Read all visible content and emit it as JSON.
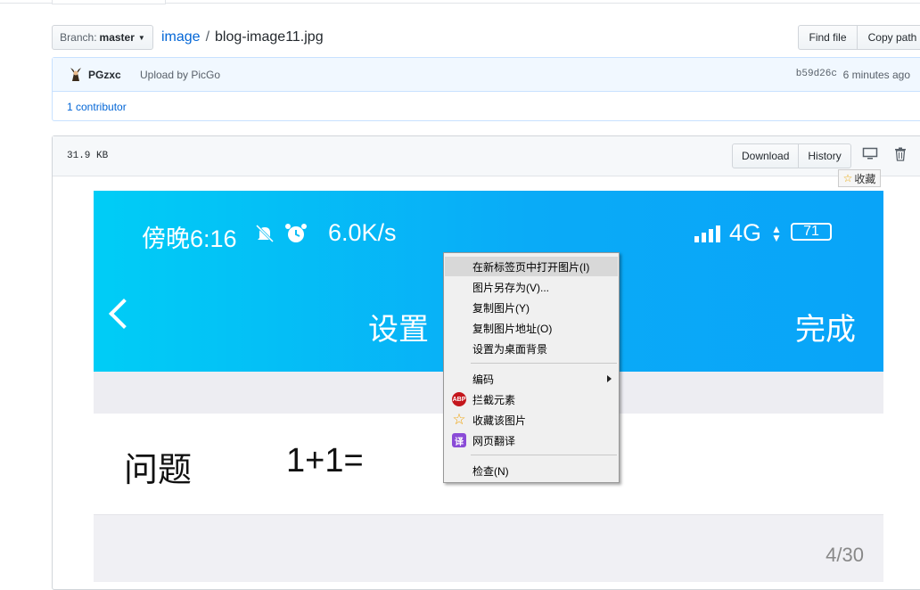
{
  "repo": {
    "branch_label": "Branch:",
    "branch_value": "master",
    "crumb_root": "image",
    "crumb_sep": "/",
    "file_name": "blog-image11.jpg",
    "find_file": "Find file",
    "copy_path": "Copy path"
  },
  "commit": {
    "author": "PGzxc",
    "message": "Upload by PicGo",
    "sha": "b59d26c",
    "time_ago": "6 minutes ago",
    "contributors": "1 contributor"
  },
  "file": {
    "size": "31.9 KB",
    "download": "Download",
    "history": "History",
    "tooltip": "收藏"
  },
  "phone": {
    "time": "傍晚6:16",
    "speed": "6.0K/s",
    "network": "4G",
    "battery": "71",
    "title": "设置",
    "done": "完成",
    "question_label": "问题",
    "question_value": "1+1=",
    "page_counter": "4/30"
  },
  "context_menu": {
    "items": [
      "在新标签页中打开图片(I)",
      "图片另存为(V)...",
      "复制图片(Y)",
      "复制图片地址(O)",
      "设置为桌面背景",
      "编码",
      "拦截元素",
      "收藏该图片",
      "网页翻译",
      "检查(N)"
    ],
    "abp_badge": "ABP",
    "translate_badge": "译"
  },
  "colors": {
    "link": "#0366d6",
    "phone_header": "#0aabf7",
    "abp_red": "#c4161c",
    "translate_purple": "#8a4bd7",
    "star_orange": "#f0a000"
  }
}
